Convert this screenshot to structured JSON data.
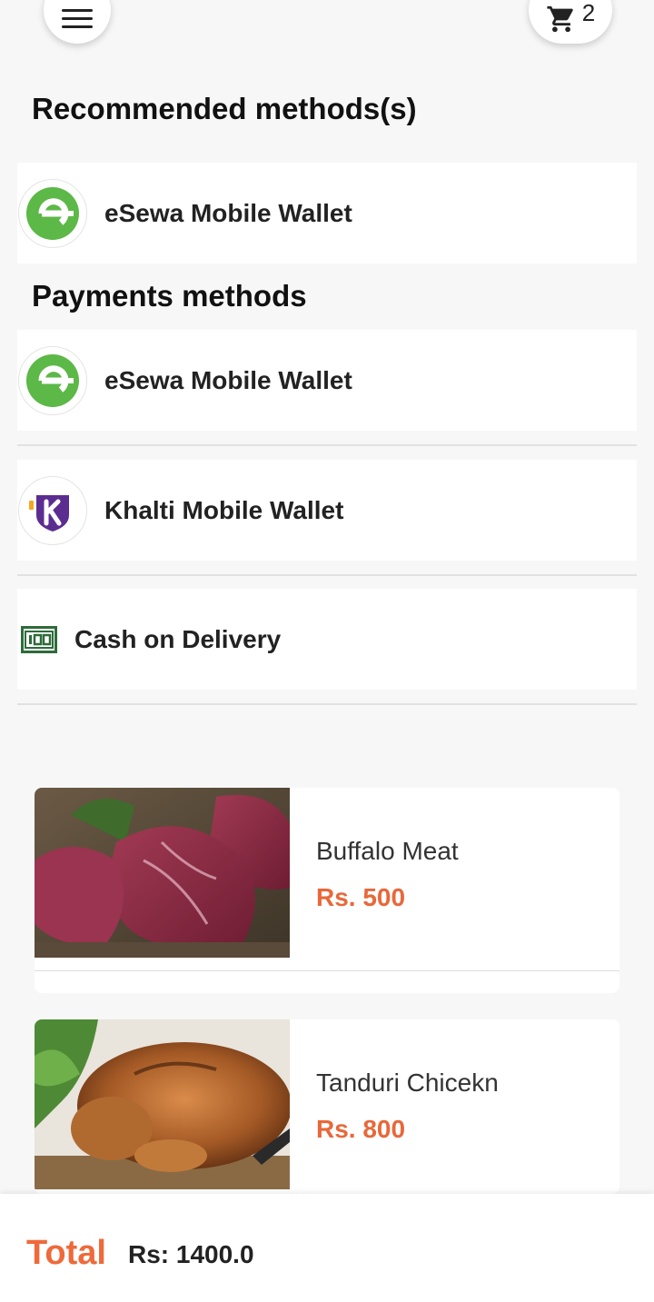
{
  "header": {
    "cart_count": "2"
  },
  "recommended": {
    "title": "Recommended methods(s)",
    "items": [
      {
        "label": "eSewa Mobile Wallet",
        "icon": "esewa-logo-icon"
      }
    ]
  },
  "payments": {
    "title": "Payments methods",
    "items": [
      {
        "label": "eSewa Mobile Wallet",
        "icon": "esewa-logo-icon"
      },
      {
        "label": "Khalti Mobile Wallet",
        "icon": "khalti-logo-icon"
      },
      {
        "label": "Cash on Delivery",
        "icon": "cash-icon"
      }
    ]
  },
  "products": [
    {
      "name": "Buffalo Meat",
      "price": "Rs. 500"
    },
    {
      "name": "Tanduri Chicekn",
      "price": "Rs. 800"
    }
  ],
  "total": {
    "label": "Total",
    "value": "Rs: 1400.0"
  },
  "colors": {
    "accent": "#e8683a",
    "esewa_green": "#5cb847",
    "khalti_purple": "#5c2d91",
    "cash_green": "#2e6b3a"
  }
}
